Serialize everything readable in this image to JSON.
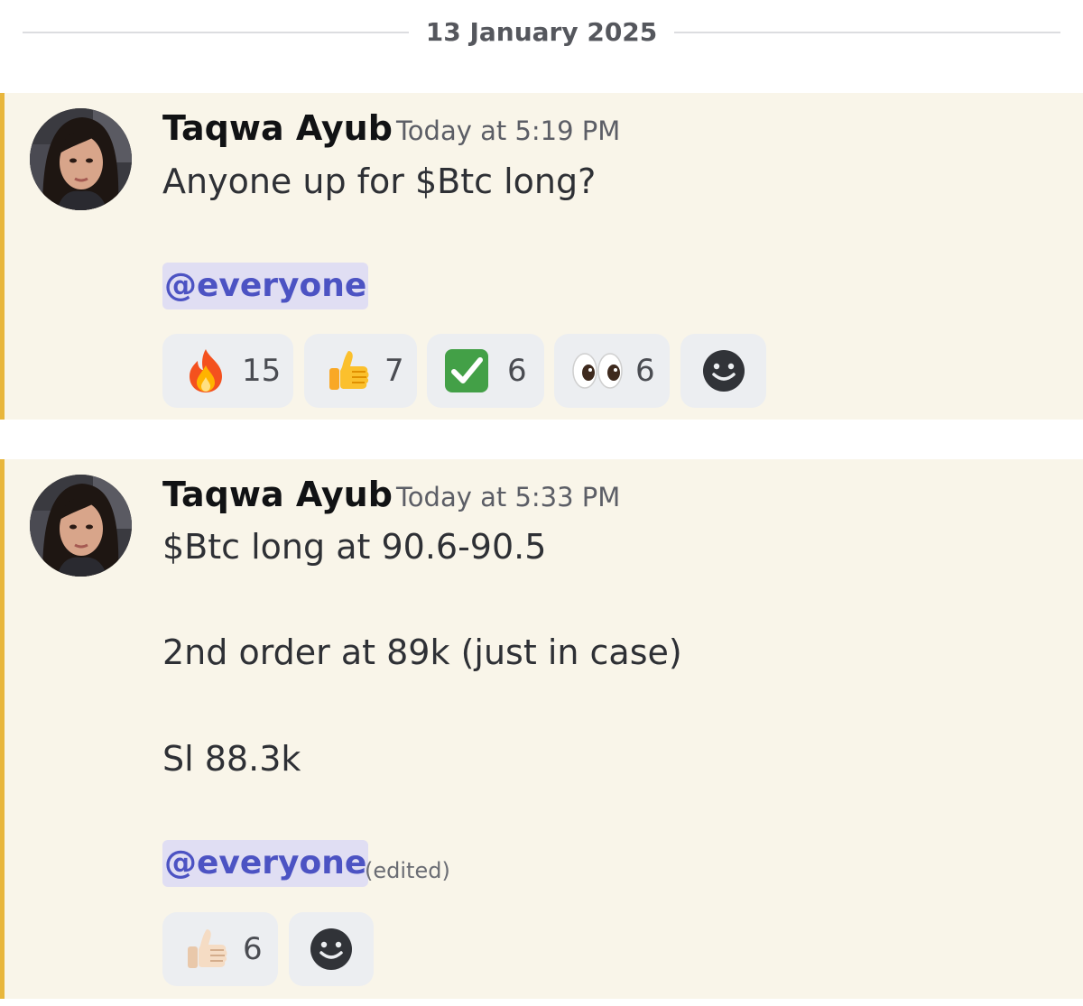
{
  "date_divider": "13 January 2025",
  "messages": [
    {
      "author": "Taqwa Ayub",
      "timestamp": "Today at 5:19 PM",
      "lines": [
        "Anyone up for $Btc long?"
      ],
      "mention": "@everyone",
      "edited": "",
      "reactions": [
        {
          "emoji": "fire-icon",
          "count": "15"
        },
        {
          "emoji": "thumbs-up-icon",
          "count": "7"
        },
        {
          "emoji": "check-mark-button-icon",
          "count": "6"
        },
        {
          "emoji": "eyes-icon",
          "count": "6"
        }
      ],
      "add_reaction_icon": "smiley-add-reaction-icon"
    },
    {
      "author": "Taqwa Ayub",
      "timestamp": "Today at 5:33 PM",
      "lines": [
        "$Btc long at 90.6-90.5",
        "2nd order at 89k (just in case)",
        "Sl 88.3k"
      ],
      "mention": "@everyone",
      "edited": "(edited)",
      "reactions": [
        {
          "emoji": "thumbs-up-light-skin-icon",
          "count": "6"
        }
      ],
      "add_reaction_icon": "smiley-add-reaction-icon"
    }
  ],
  "colors": {
    "highlight_background": "#f9f5e9",
    "highlight_bar": "#e8b63c",
    "mention_text": "#4c53c3",
    "mention_background": "#e0def3",
    "reaction_background": "#eceef1"
  }
}
